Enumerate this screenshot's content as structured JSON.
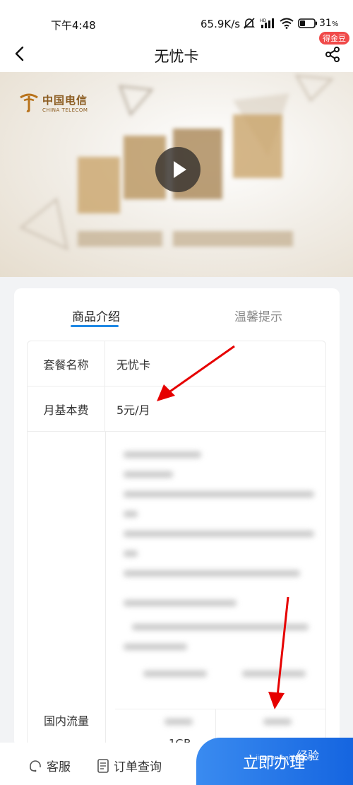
{
  "status_bar": {
    "time": "下午4:48",
    "speed": "65.9K/s",
    "battery": "31"
  },
  "nav": {
    "title": "无忧卡",
    "coin_badge": "得金豆"
  },
  "banner": {
    "logo_cn": "中国电信",
    "logo_en": "CHINA TELECOM"
  },
  "tabs": {
    "active": "商品介绍",
    "inactive": "温馨提示"
  },
  "table": {
    "rows": [
      {
        "label": "套餐名称",
        "value": "无忧卡"
      },
      {
        "label": "月基本费",
        "value": "5元/月"
      }
    ],
    "flow_label": "国内流量",
    "flow_value": "1GB"
  },
  "bottom": {
    "service": "客服",
    "order_query": "订单查询",
    "buy": "立即办理",
    "watermark": "jingyan.baidu.com",
    "watermark_big": "经验"
  },
  "colors": {
    "accent": "#1e88e5",
    "buy_button": "#1e6fe8",
    "badge": "#f04a4a",
    "arrow": "#e60000"
  }
}
